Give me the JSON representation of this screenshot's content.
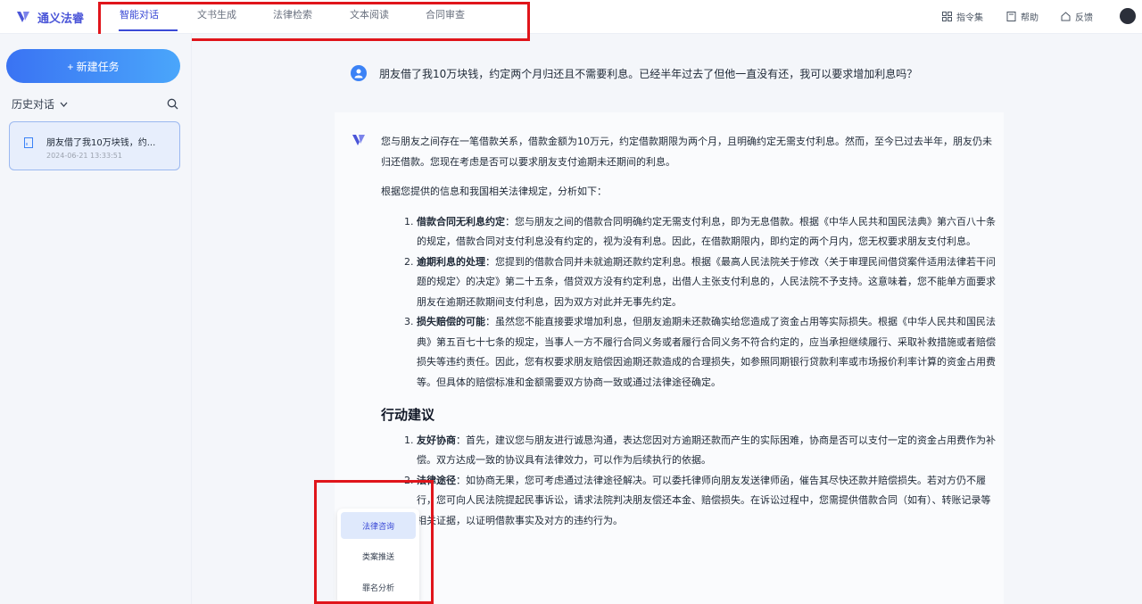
{
  "app": {
    "name": "通义法睿"
  },
  "nav": {
    "tabs": [
      {
        "label": "智能对话",
        "active": true
      },
      {
        "label": "文书生成",
        "active": false
      },
      {
        "label": "法律检索",
        "active": false
      },
      {
        "label": "文本阅读",
        "active": false
      },
      {
        "label": "合同审查",
        "active": false
      }
    ]
  },
  "toolbar": {
    "commands": {
      "label": "指令集",
      "icon": "grid-icon"
    },
    "help": {
      "label": "帮助",
      "icon": "book-icon"
    },
    "feedback": {
      "label": "反馈",
      "icon": "home-icon"
    }
  },
  "sidebar": {
    "new_task": "+ 新建任务",
    "history_label": "历史对话",
    "history_items": [
      {
        "title": "朋友借了我10万块钱，约...",
        "date": "2024-06-21 13:33:51"
      }
    ]
  },
  "chat": {
    "question": "朋友借了我10万块钱，约定两个月归还且不需要利息。已经半年过去了但他一直没有还，我可以要求增加利息吗？",
    "intro": "您与朋友之间存在一笔借款关系，借款金额为10万元，约定借款期限为两个月，且明确约定无需支付利息。然而，至今已过去半年，朋友仍未归还借款。您现在考虑是否可以要求朋友支付逾期未还期间的利息。",
    "analysis_lead": "根据您提供的信息和我国相关法律规定，分析如下：",
    "points": [
      {
        "num": "1.",
        "head": "借款合同无利息约定",
        "text": "：您与朋友之间的借款合同明确约定无需支付利息，即为无息借款。根据《中华人民共和国民法典》第六百八十条的规定，借款合同对支付利息没有约定的，视为没有利息。因此，在借款期限内，即约定的两个月内，您无权要求朋友支付利息。"
      },
      {
        "num": "2.",
        "head": "逾期利息的处理",
        "text": "：您提到的借款合同并未就逾期还款约定利息。根据《最高人民法院关于修改〈关于审理民间借贷案件适用法律若干问题的规定〉的决定》第二十五条，借贷双方没有约定利息，出借人主张支付利息的，人民法院不予支持。这意味着，您不能单方面要求朋友在逾期还款期间支付利息，因为双方对此并无事先约定。"
      },
      {
        "num": "3.",
        "head": "损失赔偿的可能",
        "text": "：虽然您不能直接要求增加利息，但朋友逾期未还款确实给您造成了资金占用等实际损失。根据《中华人民共和国民法典》第五百七十七条的规定，当事人一方不履行合同义务或者履行合同义务不符合约定的，应当承担继续履行、采取补救措施或者赔偿损失等违约责任。因此，您有权要求朋友赔偿因逾期还款造成的合理损失，如参照同期银行贷款利率或市场报价利率计算的资金占用费等。但具体的赔偿标准和金额需要双方协商一致或通过法律途径确定。"
      }
    ],
    "action_title": "行动建议",
    "actions": [
      {
        "num": "1.",
        "head": "友好协商",
        "text": "：首先，建议您与朋友进行诚恳沟通，表达您因对方逾期还款而产生的实际困难，协商是否可以支付一定的资金占用费作为补偿。双方达成一致的协议具有法律效力，可以作为后续执行的依据。"
      },
      {
        "num": "2.",
        "head": "法律途径",
        "text": "：如协商无果，您可考虑通过法律途径解决。可以委托律师向朋友发送律师函，催告其尽快还款并赔偿损失。若对方仍不履行，您可向人民法院提起民事诉讼，请求法院判决朋友偿还本金、赔偿损失。在诉讼过程中，您需提供借款合同（如有）、转账记录等相关证据，以证明借款事实及对方的违约行为。"
      }
    ]
  },
  "popup": {
    "items": [
      {
        "label": "法律咨询",
        "active": true
      },
      {
        "label": "类案推送",
        "active": false
      },
      {
        "label": "罪名分析",
        "active": false
      }
    ]
  },
  "colors": {
    "accent": "#3b4ad6",
    "highlight_box": "#e0151b",
    "button_gradient_start": "#3a73f3",
    "button_gradient_end": "#4aa6fb"
  }
}
